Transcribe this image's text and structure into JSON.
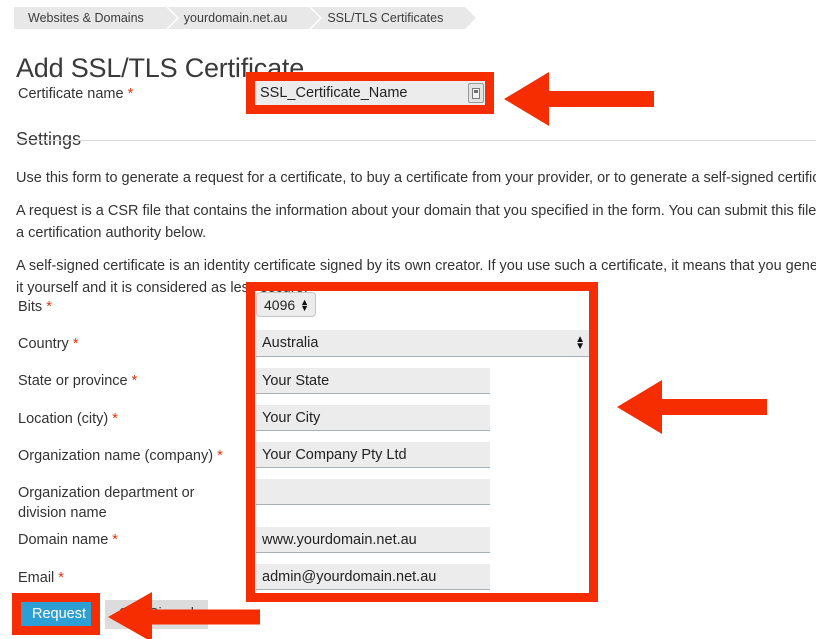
{
  "breadcrumb": {
    "items": [
      {
        "label": "Websites & Domains"
      },
      {
        "label": "yourdomain.net.au"
      },
      {
        "label": "SSL/TLS Certificates"
      }
    ]
  },
  "page": {
    "title": "Add SSL/TLS Certificate",
    "section_heading": "Settings"
  },
  "certificate_name": {
    "label": "Certificate name",
    "required_marker": "*",
    "value": "SSL_Certificate_Name",
    "field_icon": "form-autofill-icon"
  },
  "description": {
    "p1": "Use this form to generate a request for a certificate, to buy a certificate from your provider, or to generate a self-signed certificate.",
    "p2": "A request is a CSR file that contains the information about your domain that you specified in the form. You can submit this file to a certification authority below.",
    "p3": "A self-signed certificate is an identity certificate signed by its own creator. If you use such a certificate, it means that you generated it yourself and it is considered as less secure."
  },
  "form": {
    "bits": {
      "label": "Bits",
      "required_marker": "*",
      "value": "4096"
    },
    "country": {
      "label": "Country",
      "required_marker": "*",
      "value": "Australia"
    },
    "state": {
      "label": "State or province",
      "required_marker": "*",
      "value": "Your State",
      "placeholder": ""
    },
    "city": {
      "label": "Location (city)",
      "required_marker": "*",
      "value": "Your City",
      "placeholder": ""
    },
    "organization": {
      "label": "Organization name (company)",
      "required_marker": "*",
      "value": "Your Company Pty Ltd",
      "placeholder": ""
    },
    "department": {
      "label": "Organization department or division name",
      "required_marker": "",
      "value": "",
      "placeholder": ""
    },
    "domain": {
      "label": "Domain name",
      "required_marker": "*",
      "value": "www.yourdomain.net.au",
      "placeholder": ""
    },
    "email": {
      "label": "Email",
      "required_marker": "*",
      "value": "admin@yourdomain.net.au",
      "placeholder": ""
    }
  },
  "buttons": {
    "request": "Request",
    "self_signed": "Self-Signed"
  },
  "colors": {
    "annotation_red": "#f62d00",
    "primary_button_blue": "#2e9fd2",
    "required_star_red": "#e2340b",
    "input_background": "#ececec"
  }
}
